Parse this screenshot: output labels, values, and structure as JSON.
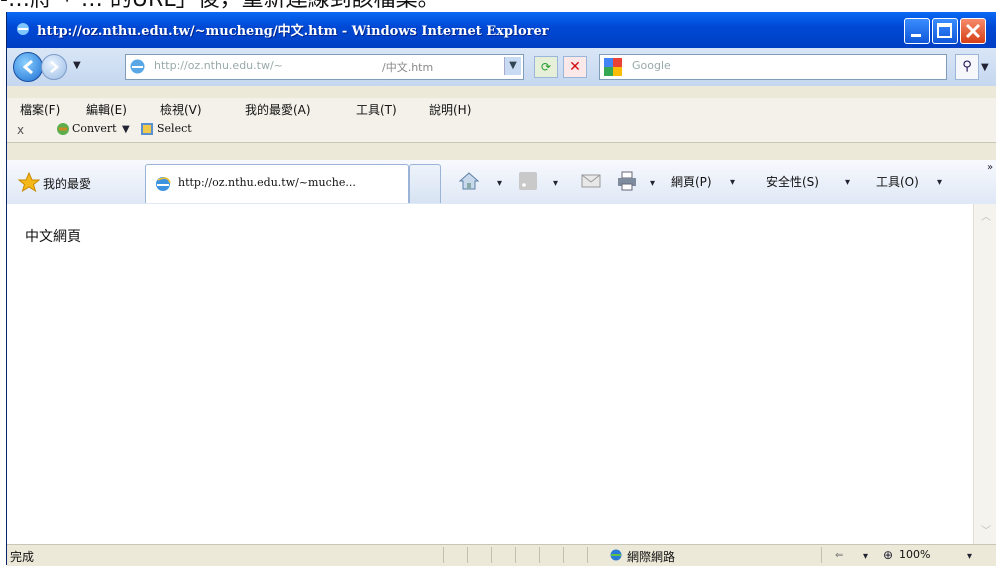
{
  "caption": "-…將「 … 的URL」後，重新連線到該檔案。",
  "window": {
    "title": "http://oz.nthu.edu.tw/~mucheng/中文.htm - Windows Internet Explorer",
    "controls": {
      "minimize": "minimize",
      "maximize": "maximize",
      "close": "close"
    }
  },
  "nav": {
    "address_left": "http://oz.nthu.edu.tw/~",
    "address_right": "/中文.htm",
    "search_placeholder": "Google"
  },
  "menu": [
    "檔案(F)",
    "編輯(E)",
    "檢視(V)",
    "我的最愛(A)",
    "工具(T)",
    "說明(H)"
  ],
  "links": {
    "close": "x",
    "convert": "Convert",
    "select": "Select"
  },
  "favbar": {
    "favorites": "我的最愛",
    "tab_title": "http://oz.nthu.edu.tw/~muche...",
    "page_menu": "網頁(P)",
    "safety_menu": "安全性(S)",
    "tools_menu": "工具(O)"
  },
  "content": {
    "text": "中文網頁"
  },
  "status": {
    "left": "完成",
    "zone": "網際網路",
    "zoom": "100%"
  },
  "colors": {
    "title_bar": "#0049d5",
    "close_button": "#d53f17",
    "toolbar": "#d9e6f7"
  }
}
